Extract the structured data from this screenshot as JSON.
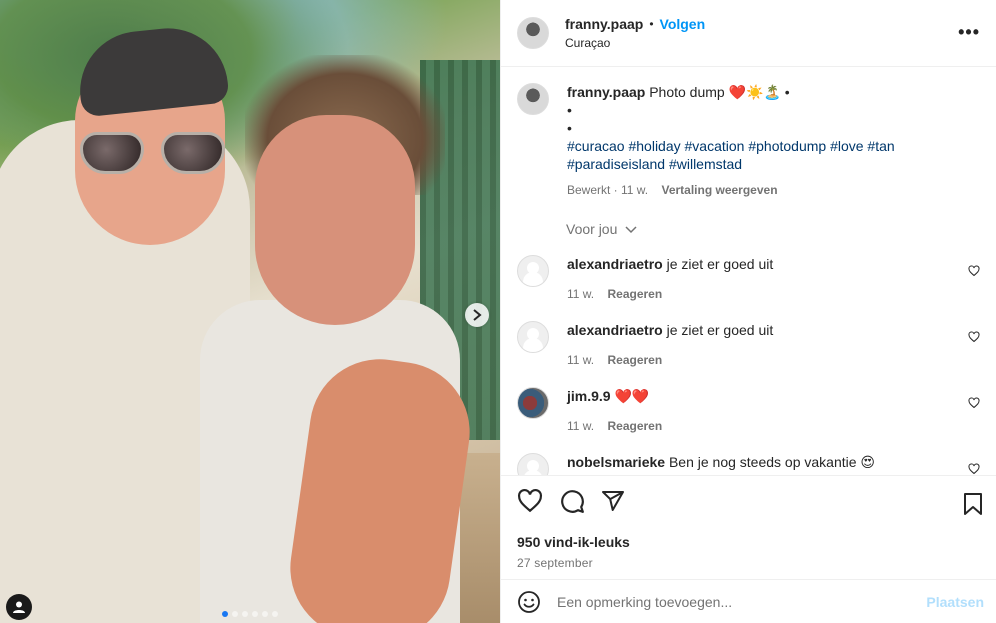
{
  "header": {
    "username": "franny.paap",
    "separator": "•",
    "follow_label": "Volgen",
    "location": "Curaçao",
    "more_label": "•••"
  },
  "caption": {
    "username": "franny.paap",
    "text": "Photo dump ❤️☀️🏝️ •",
    "bullet1": "•",
    "bullet2": "•",
    "tags_line1": "#curacao #holiday #vacation #photodump #love #tan",
    "tags_line2": "#paradiseisland #willemstad",
    "edited": "Bewerkt · 11 w.",
    "translate": "Vertaling weergeven"
  },
  "for_you": "Voor jou",
  "comments": [
    {
      "user": "alexandriaetro",
      "text": "je ziet er goed uit",
      "time": "11 w.",
      "reply": "Reageren"
    },
    {
      "user": "alexandriaetro",
      "text": "je ziet er goed uit",
      "time": "11 w.",
      "reply": "Reageren"
    },
    {
      "user": "jim.9.9",
      "text": "❤️❤️",
      "time": "11 w.",
      "reply": "Reageren"
    },
    {
      "user": "nobelsmarieke",
      "text": "Ben je nog steeds op vakantie 😍"
    }
  ],
  "stats": {
    "likes": "950 vind-ik-leuks",
    "date": "27 september"
  },
  "add_comment": {
    "placeholder": "Een opmerking toevoegen...",
    "post_label": "Plaatsen"
  },
  "carousel": {
    "count": 6,
    "active_index": 0
  },
  "colors": {
    "link": "#0095f6",
    "hashtag": "#00376b",
    "muted": "#737373",
    "post_disabled": "#b2dffc"
  }
}
